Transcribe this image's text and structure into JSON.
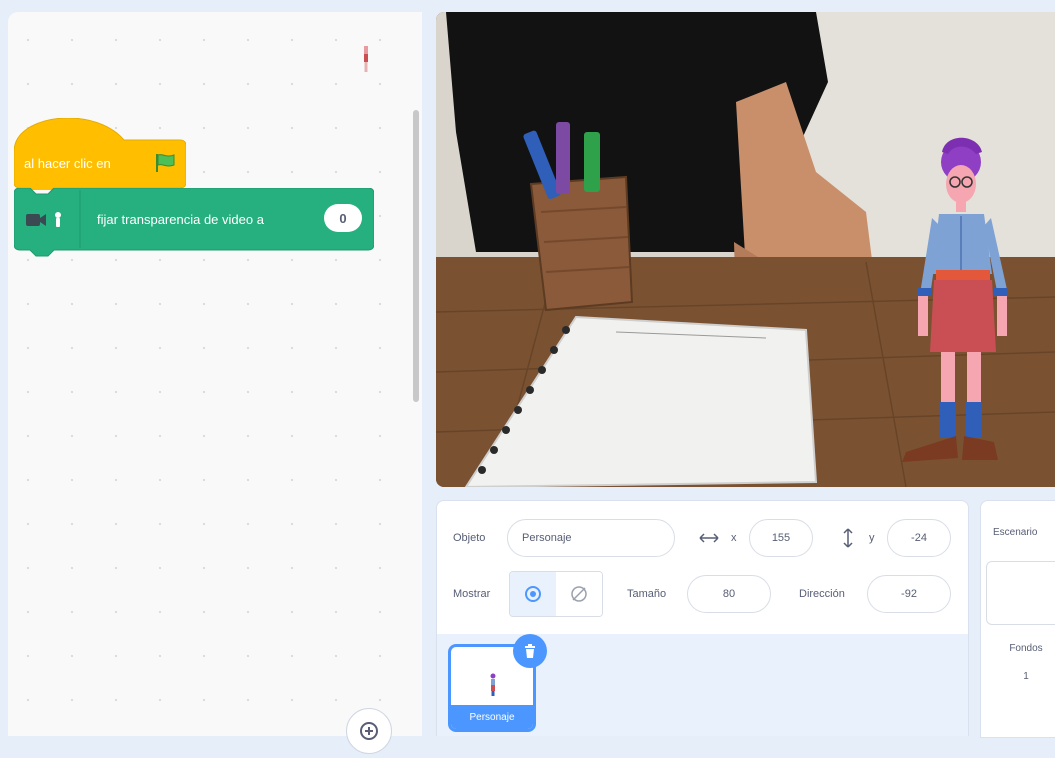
{
  "code": {
    "hat_label": "al hacer clic en",
    "block_label": "fijar transparencia de video a",
    "block_value": "0",
    "icons": {
      "hat": "green-flag-icon",
      "extension": "video-camera-icon",
      "zoom": "zoom-in-icon"
    }
  },
  "sprite_info": {
    "sprite_label": "Objeto",
    "sprite_name": "Personaje",
    "x_label": "x",
    "x_value": "155",
    "y_label": "y",
    "y_value": "-24",
    "show_label": "Mostrar",
    "size_label": "Tamaño",
    "size_value": "80",
    "direction_label": "Dirección",
    "direction_value": "-92"
  },
  "sprite_list": {
    "sprites": [
      {
        "name": "Personaje",
        "selected": true
      }
    ]
  },
  "stage_pane": {
    "title": "Escenario",
    "backdrops_label": "Fondos",
    "backdrops_count": "1"
  },
  "colors": {
    "events_block": "#ffbf00",
    "extension_block": "#26b07f",
    "selected_accent": "#4c97ff"
  }
}
